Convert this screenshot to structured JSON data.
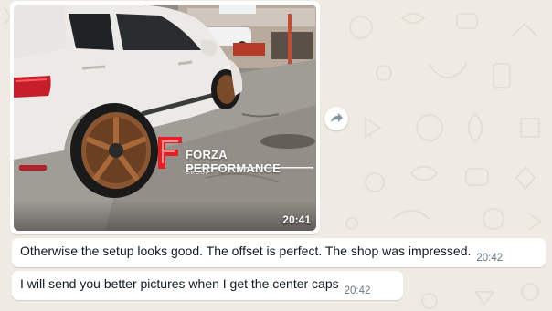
{
  "chat": {
    "image_message": {
      "time": "20:41",
      "watermark_brand": "FORZA PERFORMANCE",
      "watermark_sub": "GROUP"
    },
    "messages": [
      {
        "text": "Otherwise the setup looks good. The offset is perfect. The shop was impressed.",
        "time": "20:42"
      },
      {
        "text": "I will send you better pictures when I get the center caps",
        "time": "20:42"
      }
    ]
  },
  "colors": {
    "chat_background": "#efeae2",
    "bubble": "#ffffff",
    "timestamp": "#667781",
    "brand_red": "#e31e24"
  }
}
